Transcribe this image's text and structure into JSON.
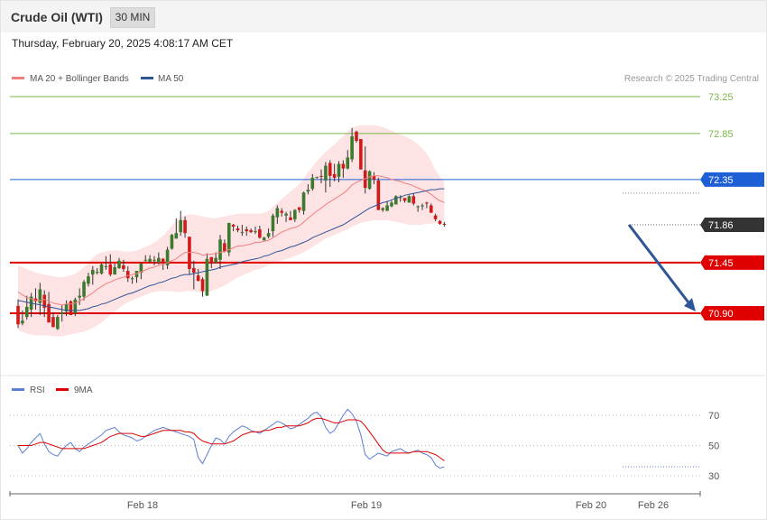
{
  "header": {
    "instrument": "Crude Oil (WTI)",
    "timeframe": "30 MIN",
    "datetime": "Thursday, February 20, 2025 4:08:17 AM CET"
  },
  "legend": {
    "items": [
      {
        "label": "MA 20 + Bollinger Bands",
        "color": "#f08080"
      },
      {
        "label": "MA 50",
        "color": "#2f5597"
      }
    ],
    "source": "Research © 2025 Trading Central"
  },
  "rsi_legend": {
    "items": [
      {
        "label": "RSI",
        "color": "#5b7fd4"
      },
      {
        "label": "9MA",
        "color": "#e00000"
      }
    ]
  },
  "chart_data": [
    {
      "type": "candlestick",
      "ylim": [
        70.64,
        73.44
      ],
      "levels": [
        {
          "label": "73.25",
          "value": 73.25,
          "kind": "target",
          "color": "#7ab648"
        },
        {
          "label": "72.85",
          "value": 72.85,
          "kind": "target",
          "color": "#7ab648"
        },
        {
          "label": "72.35",
          "value": 72.35,
          "kind": "pivot",
          "color": "#1f5fd6"
        },
        {
          "label": "71.86",
          "value": 71.86,
          "kind": "last",
          "color": "#333333"
        },
        {
          "label": "71.45",
          "value": 71.45,
          "kind": "support",
          "color": "#e00000"
        },
        {
          "label": "70.90",
          "value": 70.9,
          "kind": "support",
          "color": "#e00000"
        }
      ],
      "projection": {
        "from": 71.86,
        "to": 70.9,
        "direction": "down",
        "color": "#2f5597"
      },
      "x_ticks": [
        "Feb 18",
        "Feb 19",
        "Feb 20",
        "Feb 26"
      ],
      "candles": [
        [
          70.98,
          71.05,
          70.74,
          70.78
        ],
        [
          70.79,
          70.93,
          70.77,
          70.82
        ],
        [
          70.86,
          71.09,
          70.83,
          70.97
        ],
        [
          70.94,
          71.12,
          70.86,
          71.08
        ],
        [
          71.06,
          71.17,
          70.94,
          71.03
        ],
        [
          71.01,
          71.23,
          70.88,
          71.16
        ],
        [
          71.1,
          71.15,
          70.86,
          70.96
        ],
        [
          71.0,
          71.13,
          70.8,
          70.8
        ],
        [
          70.86,
          70.91,
          70.75,
          70.75
        ],
        [
          70.73,
          70.88,
          70.72,
          70.86
        ],
        [
          70.89,
          70.99,
          70.81,
          70.91
        ],
        [
          70.92,
          71.04,
          70.87,
          71.0
        ],
        [
          71.03,
          71.04,
          70.88,
          70.88
        ],
        [
          70.9,
          71.07,
          70.87,
          71.05
        ],
        [
          71.07,
          71.17,
          70.99,
          71.09
        ],
        [
          71.08,
          71.26,
          71.04,
          71.24
        ],
        [
          71.22,
          71.34,
          71.19,
          71.3
        ],
        [
          71.32,
          71.41,
          71.21,
          71.37
        ],
        [
          71.34,
          71.39,
          71.32,
          71.35
        ],
        [
          71.33,
          71.44,
          71.32,
          71.43
        ],
        [
          71.4,
          71.52,
          71.37,
          71.41
        ],
        [
          71.43,
          71.54,
          71.3,
          71.32
        ],
        [
          71.32,
          71.44,
          71.32,
          71.4
        ],
        [
          71.39,
          71.5,
          71.38,
          71.47
        ],
        [
          71.42,
          71.48,
          71.35,
          71.38
        ],
        [
          71.36,
          71.41,
          71.24,
          71.28
        ],
        [
          71.27,
          71.3,
          71.22,
          71.28
        ],
        [
          71.29,
          71.36,
          71.23,
          71.36
        ],
        [
          71.34,
          71.44,
          71.27,
          71.44
        ],
        [
          71.47,
          71.53,
          71.46,
          71.48
        ],
        [
          71.46,
          71.53,
          71.45,
          71.49
        ],
        [
          71.47,
          71.52,
          71.42,
          71.48
        ],
        [
          71.45,
          71.56,
          71.43,
          71.5
        ],
        [
          71.49,
          71.5,
          71.37,
          71.44
        ],
        [
          71.42,
          71.62,
          71.38,
          71.59
        ],
        [
          71.6,
          71.76,
          71.59,
          71.75
        ],
        [
          71.71,
          71.93,
          71.71,
          71.77
        ],
        [
          71.78,
          72.01,
          71.74,
          71.91
        ],
        [
          71.91,
          71.95,
          71.72,
          71.77
        ],
        [
          71.73,
          71.73,
          71.32,
          71.38
        ],
        [
          71.39,
          71.47,
          71.16,
          71.34
        ],
        [
          71.31,
          71.38,
          71.25,
          71.25
        ],
        [
          71.27,
          71.29,
          71.08,
          71.14
        ],
        [
          71.09,
          71.55,
          71.09,
          71.49
        ],
        [
          71.51,
          71.51,
          71.39,
          71.45
        ],
        [
          71.45,
          71.56,
          71.44,
          71.5
        ],
        [
          71.48,
          71.75,
          71.38,
          71.7
        ],
        [
          71.66,
          71.7,
          71.56,
          71.57
        ],
        [
          71.56,
          71.88,
          71.52,
          71.88
        ],
        [
          71.86,
          71.87,
          71.79,
          71.84
        ],
        [
          71.82,
          71.85,
          71.78,
          71.8
        ],
        [
          71.78,
          71.86,
          71.74,
          71.78
        ],
        [
          71.81,
          71.84,
          71.74,
          71.79
        ],
        [
          71.8,
          71.82,
          71.77,
          71.78
        ],
        [
          71.78,
          71.84,
          71.76,
          71.79
        ],
        [
          71.81,
          71.85,
          71.71,
          71.72
        ],
        [
          71.69,
          71.73,
          71.69,
          71.72
        ],
        [
          71.73,
          71.82,
          71.71,
          71.77
        ],
        [
          71.79,
          71.98,
          71.73,
          71.96
        ],
        [
          71.94,
          72.07,
          71.87,
          72.04
        ],
        [
          72.01,
          72.04,
          71.95,
          71.99
        ],
        [
          71.96,
          72.0,
          71.89,
          71.98
        ],
        [
          71.94,
          72.01,
          71.91,
          71.91
        ],
        [
          71.92,
          72.03,
          71.89,
          72.02
        ],
        [
          72.05,
          72.05,
          71.99,
          72.02
        ],
        [
          72.01,
          72.22,
          71.97,
          72.21
        ],
        [
          72.22,
          72.3,
          72.19,
          72.24
        ],
        [
          72.25,
          72.41,
          72.23,
          72.37
        ],
        [
          72.38,
          72.38,
          72.36,
          72.38
        ],
        [
          72.39,
          72.46,
          72.31,
          72.38
        ],
        [
          72.34,
          72.54,
          72.21,
          72.5
        ],
        [
          72.53,
          72.56,
          72.27,
          72.39
        ],
        [
          72.41,
          72.52,
          72.33,
          72.37
        ],
        [
          72.38,
          72.55,
          72.32,
          72.52
        ],
        [
          72.52,
          72.56,
          72.37,
          72.47
        ],
        [
          72.47,
          72.67,
          72.46,
          72.59
        ],
        [
          72.57,
          72.91,
          72.54,
          72.82
        ],
        [
          72.87,
          72.88,
          72.75,
          72.77
        ],
        [
          72.79,
          72.79,
          72.46,
          72.46
        ],
        [
          72.45,
          72.71,
          72.2,
          72.26
        ],
        [
          72.25,
          72.45,
          72.24,
          72.44
        ],
        [
          72.39,
          72.43,
          72.3,
          72.35
        ],
        [
          72.34,
          72.37,
          72.02,
          72.02
        ],
        [
          72.02,
          72.05,
          72.0,
          72.04
        ],
        [
          72.01,
          72.12,
          72.01,
          72.07
        ],
        [
          72.06,
          72.12,
          72.05,
          72.1
        ],
        [
          72.08,
          72.18,
          72.08,
          72.17
        ],
        [
          72.15,
          72.18,
          72.11,
          72.16
        ],
        [
          72.15,
          72.15,
          72.1,
          72.12
        ],
        [
          72.1,
          72.18,
          72.1,
          72.17
        ],
        [
          72.17,
          72.2,
          72.07,
          72.09
        ],
        [
          72.06,
          72.07,
          72.0,
          72.06
        ],
        [
          72.06,
          72.09,
          72.02,
          72.07
        ],
        [
          72.1,
          72.11,
          72.04,
          72.09
        ],
        [
          72.07,
          72.09,
          71.99,
          71.99
        ],
        [
          71.96,
          71.98,
          71.9,
          71.92
        ],
        [
          71.9,
          71.91,
          71.86,
          71.87
        ],
        [
          71.87,
          71.89,
          71.84,
          71.86
        ]
      ],
      "ma20": [
        71.13,
        71.1,
        71.07,
        71.06,
        71.04,
        71.04,
        71.05,
        71.03,
        71.01,
        71.0,
        70.99,
        71.0,
        71.0,
        71.01,
        71.03,
        71.06,
        71.09,
        71.12,
        71.16,
        71.19,
        71.22,
        71.24,
        71.26,
        71.28,
        71.29,
        71.31,
        71.32,
        71.33,
        71.35,
        71.37,
        71.39,
        71.4,
        71.42,
        71.43,
        71.45,
        71.47,
        71.49,
        71.53,
        71.56,
        71.56,
        71.56,
        71.55,
        71.53,
        71.54,
        71.54,
        71.55,
        71.56,
        71.57,
        71.59,
        71.61,
        71.63,
        71.63,
        71.64,
        71.65,
        71.67,
        71.67,
        71.68,
        71.69,
        71.72,
        71.75,
        71.78,
        71.8,
        71.82,
        71.83,
        71.85,
        71.89,
        71.93,
        71.97,
        72.01,
        72.04,
        72.08,
        72.11,
        72.14,
        72.17,
        72.2,
        72.24,
        72.29,
        72.32,
        72.34,
        72.36,
        72.38,
        72.39,
        72.39,
        72.38,
        72.37,
        72.35,
        72.34,
        72.33,
        72.31,
        72.3,
        72.28,
        72.26,
        72.24,
        72.22,
        72.19,
        72.15,
        72.12,
        72.1
      ],
      "ma50": [
        71.04,
        71.03,
        71.02,
        71.01,
        71.0,
        70.99,
        70.98,
        70.97,
        70.96,
        70.95,
        70.94,
        70.93,
        70.93,
        70.93,
        70.93,
        70.94,
        70.95,
        70.97,
        70.98,
        71.0,
        71.01,
        71.03,
        71.05,
        71.07,
        71.09,
        71.11,
        71.12,
        71.14,
        71.16,
        71.18,
        71.2,
        71.21,
        71.23,
        71.24,
        71.26,
        71.28,
        71.29,
        71.31,
        71.32,
        71.32,
        71.33,
        71.34,
        71.35,
        71.36,
        71.37,
        71.38,
        71.4,
        71.41,
        71.42,
        71.43,
        71.44,
        71.46,
        71.47,
        71.48,
        71.49,
        71.5,
        71.52,
        71.53,
        71.55,
        71.57,
        71.58,
        71.6,
        71.62,
        71.63,
        71.65,
        71.67,
        71.69,
        71.72,
        71.74,
        71.76,
        71.78,
        71.8,
        71.82,
        71.84,
        71.86,
        71.89,
        71.92,
        71.95,
        71.98,
        72.01,
        72.04,
        72.06,
        72.08,
        72.1,
        72.11,
        72.13,
        72.15,
        72.16,
        72.18,
        72.19,
        72.2,
        72.21,
        72.22,
        72.23,
        72.24,
        72.24,
        72.25,
        72.25
      ],
      "bb_upper": [
        71.42,
        71.4,
        71.38,
        71.36,
        71.34,
        71.33,
        71.32,
        71.31,
        71.3,
        71.29,
        71.29,
        71.3,
        71.31,
        71.33,
        71.36,
        71.4,
        71.45,
        71.5,
        71.54,
        71.56,
        71.57,
        71.58,
        71.58,
        71.58,
        71.57,
        71.57,
        71.57,
        71.58,
        71.6,
        71.62,
        71.64,
        71.67,
        71.7,
        71.74,
        71.79,
        71.85,
        71.9,
        71.94,
        71.96,
        71.97,
        71.97,
        71.96,
        71.95,
        71.94,
        71.93,
        71.93,
        71.94,
        71.95,
        71.96,
        71.97,
        71.98,
        71.98,
        71.98,
        71.98,
        71.98,
        71.98,
        71.99,
        72.01,
        72.05,
        72.1,
        72.14,
        72.18,
        72.22,
        72.26,
        72.3,
        72.36,
        72.43,
        72.49,
        72.55,
        72.6,
        72.65,
        72.69,
        72.73,
        72.78,
        72.82,
        72.87,
        72.91,
        72.93,
        72.94,
        72.94,
        72.94,
        72.94,
        72.93,
        72.92,
        72.9,
        72.88,
        72.86,
        72.84,
        72.82,
        72.8,
        72.77,
        72.73,
        72.69,
        72.63,
        72.55,
        72.45,
        72.38,
        72.33
      ],
      "bb_lower": [
        70.72,
        70.7,
        70.68,
        70.67,
        70.66,
        70.66,
        70.66,
        70.66,
        70.65,
        70.65,
        70.65,
        70.66,
        70.67,
        70.68,
        70.69,
        70.7,
        70.72,
        70.74,
        70.77,
        70.8,
        70.84,
        70.88,
        70.92,
        70.96,
        70.99,
        71.02,
        71.04,
        71.06,
        71.08,
        71.1,
        71.12,
        71.13,
        71.14,
        71.14,
        71.14,
        71.14,
        71.13,
        71.13,
        71.14,
        71.14,
        71.14,
        71.13,
        71.12,
        71.13,
        71.14,
        71.16,
        71.18,
        71.2,
        71.23,
        71.26,
        71.29,
        71.31,
        71.33,
        71.35,
        71.37,
        71.38,
        71.4,
        71.42,
        71.44,
        71.46,
        71.47,
        71.49,
        71.5,
        71.52,
        71.54,
        71.56,
        71.59,
        71.62,
        71.65,
        71.68,
        71.71,
        71.73,
        71.75,
        71.77,
        71.79,
        71.81,
        71.84,
        71.86,
        71.88,
        71.89,
        71.9,
        71.91,
        71.91,
        71.91,
        71.91,
        71.9,
        71.89,
        71.88,
        71.87,
        71.86,
        71.86,
        71.86,
        71.86,
        71.87,
        71.87,
        71.88,
        71.89,
        71.9
      ]
    },
    {
      "type": "line",
      "series_names": [
        "RSI",
        "9MA"
      ],
      "ylim": [
        20,
        80
      ],
      "y_ticks": [
        70,
        50,
        30
      ],
      "rsi": [
        50,
        45,
        48,
        52,
        55,
        58,
        51,
        46,
        44,
        43,
        47,
        50,
        52,
        48,
        46,
        49,
        51,
        53,
        55,
        57,
        60,
        61,
        62,
        59,
        57,
        56,
        55,
        53,
        54,
        56,
        58,
        60,
        61,
        62,
        61,
        60,
        59,
        58,
        57,
        56,
        54,
        42,
        38,
        44,
        50,
        55,
        54,
        51,
        56,
        59,
        61,
        63,
        62,
        60,
        59,
        58,
        60,
        62,
        64,
        66,
        65,
        63,
        61,
        62,
        64,
        66,
        68,
        71,
        72,
        69,
        62,
        58,
        60,
        65,
        70,
        74,
        71,
        66,
        57,
        44,
        41,
        43,
        45,
        44,
        43,
        46,
        47,
        48,
        46,
        45,
        46,
        47,
        45,
        44,
        42,
        37,
        35,
        36
      ],
      "ma": [
        50,
        50,
        50,
        50,
        51,
        52,
        52,
        51,
        50,
        49,
        48,
        48,
        48,
        48,
        48,
        48,
        49,
        50,
        51,
        52,
        54,
        56,
        57,
        58,
        58,
        58,
        58,
        57,
        56,
        56,
        57,
        58,
        59,
        60,
        60,
        60,
        60,
        60,
        59,
        59,
        58,
        55,
        53,
        52,
        51,
        51,
        51,
        51,
        52,
        53,
        55,
        57,
        58,
        59,
        59,
        59,
        60,
        60,
        61,
        62,
        62,
        63,
        63,
        63,
        63,
        64,
        65,
        67,
        68,
        68,
        67,
        66,
        65,
        65,
        66,
        67,
        67,
        67,
        66,
        63,
        59,
        55,
        51,
        47,
        45,
        45,
        45,
        45,
        45,
        45,
        46,
        46,
        46,
        46,
        45,
        44,
        42,
        40
      ]
    }
  ]
}
